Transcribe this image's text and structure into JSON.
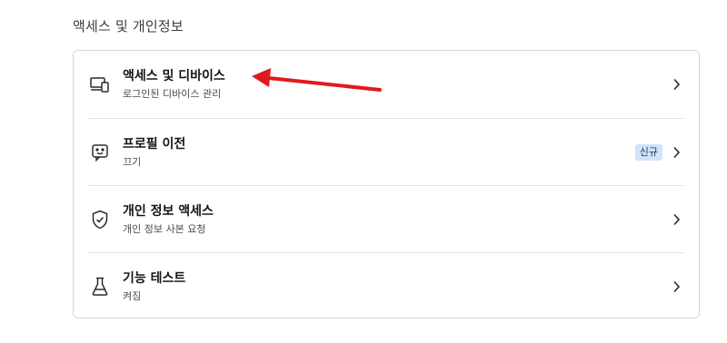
{
  "section": {
    "title": "액세스 및 개인정보"
  },
  "rows": [
    {
      "icon": "devices-icon",
      "title": "액세스 및 디바이스",
      "subtitle": "로그인된 디바이스 관리",
      "badge": ""
    },
    {
      "icon": "profile-transfer-icon",
      "title": "프로필 이전",
      "subtitle": "끄기",
      "badge": "신규"
    },
    {
      "icon": "shield-check-icon",
      "title": "개인 정보 액세스",
      "subtitle": "개인 정보 사본 요청",
      "badge": ""
    },
    {
      "icon": "flask-icon",
      "title": "기능 테스트",
      "subtitle": "켜짐",
      "badge": ""
    }
  ],
  "colors": {
    "annotation_arrow": "#e0191e",
    "badge_background": "#cfe3fb",
    "card_border": "#d6d6d6"
  }
}
